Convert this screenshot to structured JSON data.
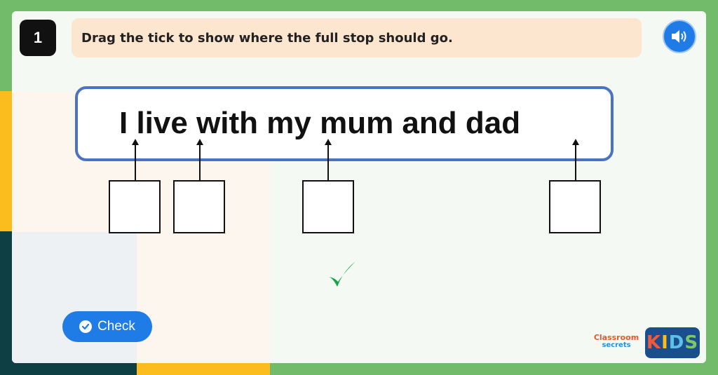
{
  "question": {
    "number": "1",
    "instruction": "Drag the tick to show where the full stop should go."
  },
  "sentence": {
    "text": "I live with my mum and dad"
  },
  "drop_targets": [
    {
      "label": ""
    },
    {
      "label": ""
    },
    {
      "label": ""
    },
    {
      "label": ""
    }
  ],
  "draggable": {
    "symbol": "✓",
    "color": "#16a34a"
  },
  "buttons": {
    "check_label": "Check"
  },
  "branding": {
    "classroom_line1": "Classroom",
    "classroom_line2": "secrets",
    "kids_k": "K",
    "kids_i": "I",
    "kids_d": "D",
    "kids_s": "S"
  },
  "colors": {
    "accent_blue": "#1f7be6",
    "sentence_border": "#4a74c0",
    "question_bg": "#fde6cf",
    "outer_green": "#72bb6a"
  },
  "icons": {
    "audio": "speaker-icon",
    "check": "check-circle-icon",
    "tick": "tick-icon"
  }
}
